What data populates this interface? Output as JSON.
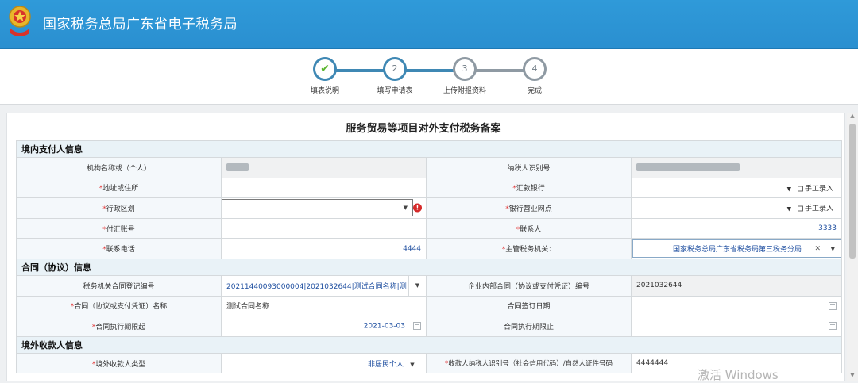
{
  "header": {
    "title": "国家税务总局广东省电子税务局"
  },
  "steps": [
    {
      "num": "✔",
      "label": "填表说明"
    },
    {
      "num": "2",
      "label": "填写申请表"
    },
    {
      "num": "3",
      "label": "上传附报资料"
    },
    {
      "num": "4",
      "label": "完成"
    }
  ],
  "form": {
    "title": "服务贸易等项目对外支付税务备案",
    "required_mark": "*",
    "manual_label": "手工录入",
    "sections": {
      "payer": "境内支付人信息",
      "contract": "合同（协议）信息",
      "payee": "境外收款人信息"
    },
    "labels": {
      "org_name": "机构名称或（个人）",
      "taxpayer_id": "纳税人识别号",
      "address": "地址或住所",
      "remit_bank": "汇款银行",
      "admin_region": "行政区划",
      "bank_branch": "银行营业网点",
      "remit_account": "付汇账号",
      "contact": "联系人",
      "phone": "联系电话",
      "tax_authority": "主管税务机关：",
      "contract_reg_no": "税务机关合同登记编号",
      "internal_contract_no": "企业内部合同（协议或支付凭证）编号",
      "contract_name": "合同（协议或支付凭证）名称",
      "sign_date": "合同签订日期",
      "exec_start": "合同执行期限起",
      "exec_end": "合同执行期限止",
      "payee_type": "境外收款人类型",
      "payee_id": "收款人纳税人识别号（社会信用代码）/自然人证件号码"
    },
    "values": {
      "contact": "3333",
      "phone": "4444",
      "tax_authority": "国家税务总局广东省税务局第三税务分局",
      "contract_reg_no": "20211440093000004|2021032644|测试合同名称|测",
      "internal_contract_no": "2021032644",
      "contract_name": "测试合同名称",
      "exec_start": "2021-03-03",
      "payee_type": "非居民个人",
      "payee_id": "4444444"
    }
  },
  "watermark": "激活 Windows"
}
